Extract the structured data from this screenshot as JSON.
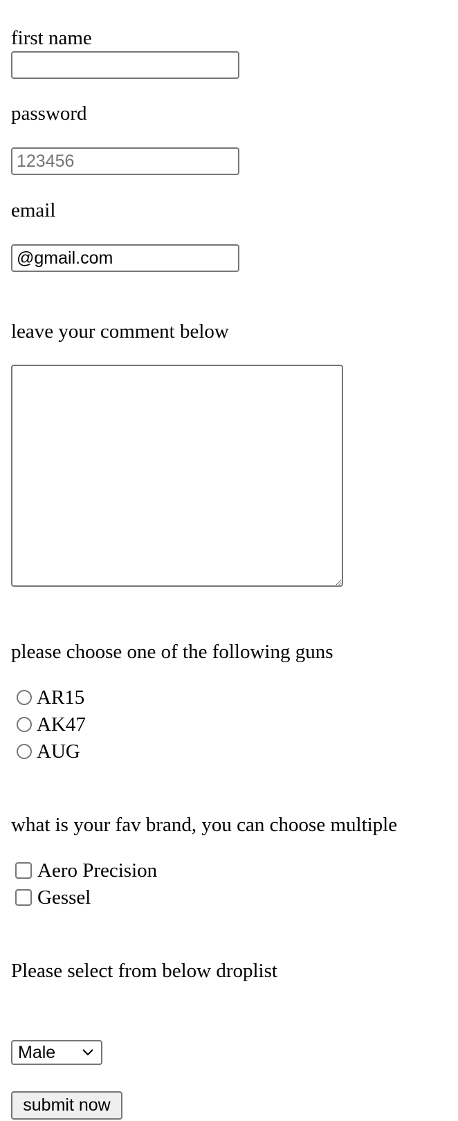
{
  "form": {
    "first_name": {
      "label": "first name",
      "value": "",
      "placeholder": ""
    },
    "password": {
      "label": "password",
      "value": "",
      "placeholder": "123456"
    },
    "email": {
      "label": "email",
      "value": "@gmail.com",
      "placeholder": ""
    },
    "comment": {
      "label": "leave your comment below",
      "value": ""
    },
    "guns": {
      "label": "please choose one of the following guns",
      "options": [
        {
          "label": "AR15",
          "selected": false
        },
        {
          "label": "AK47",
          "selected": false
        },
        {
          "label": "AUG",
          "selected": false
        }
      ]
    },
    "brands": {
      "label": "what is your fav brand, you can choose multiple",
      "options": [
        {
          "label": "Aero Precision",
          "checked": false
        },
        {
          "label": "Gessel",
          "checked": false
        }
      ]
    },
    "droplist": {
      "label": "Please select from below droplist",
      "selected": "Male",
      "icon": "chevron-down-icon"
    },
    "submit_label": "submit now"
  }
}
